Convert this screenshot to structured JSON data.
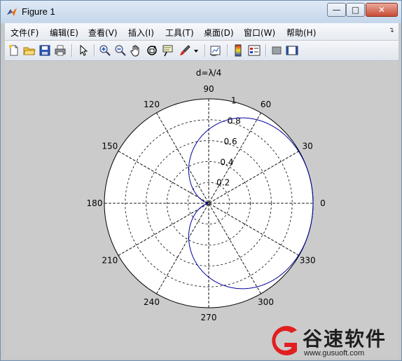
{
  "window": {
    "title": "Figure 1"
  },
  "menu": [
    "文件(F)",
    "编辑(E)",
    "查看(V)",
    "插入(I)",
    "工具(T)",
    "桌面(D)",
    "窗口(W)",
    "帮助(H)"
  ],
  "toolbar": {
    "icons": [
      "new-figure-icon",
      "open-file-icon",
      "save-icon",
      "print-icon",
      "edit-plot-arrow-icon",
      "zoom-in-icon",
      "zoom-out-icon",
      "pan-hand-icon",
      "rotate-3d-icon",
      "data-cursor-icon",
      "brush-icon",
      "brush-dropdown-icon",
      "link-plot-icon",
      "colorbar-icon",
      "legend-icon",
      "hide-plot-tools-icon",
      "show-plot-tools-icon"
    ]
  },
  "chart_data": {
    "type": "polar",
    "title": "d=λ/4",
    "radial_ticks": [
      "0.2",
      "0.4",
      "0.6",
      "0.8",
      "1"
    ],
    "angle_ticks": [
      "0",
      "30",
      "60",
      "90",
      "120",
      "150",
      "180",
      "210",
      "240",
      "270",
      "300",
      "330"
    ],
    "rlim": [
      0,
      1
    ],
    "grid": true,
    "series": [
      {
        "expression": "|cos(π/4·(cos θ − 1))|",
        "color": "#0000a0"
      }
    ],
    "colors": {
      "axes_bg": "#ffffff",
      "grid": "#000000",
      "curve": "#0000a0"
    }
  },
  "watermark": {
    "text": "谷速软件",
    "url": "www.gusuoft.com"
  }
}
